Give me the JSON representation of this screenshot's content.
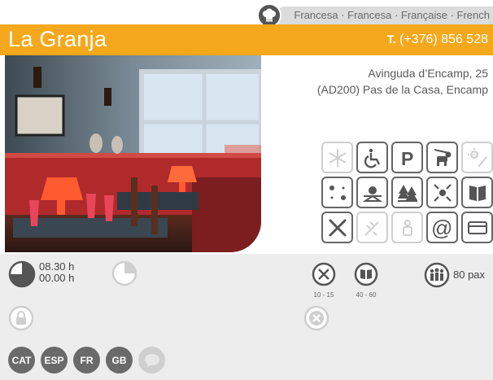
{
  "cuisine": {
    "text": "Francesa · Francesa · Française · French"
  },
  "restaurant": {
    "name": "La Granja",
    "phone_prefix": "T.",
    "phone": " (+376) 856 528",
    "address_line1": "Avinguda d’Encamp, 25",
    "address_line2": "(AD200) Pas de la Casa, Encamp"
  },
  "hours": {
    "open": "08.30 h",
    "close": "00.00 h"
  },
  "prices": {
    "menu": "10 - 15",
    "carta": "40 - 60"
  },
  "capacity": {
    "label": "80 pax"
  },
  "languages": [
    "CAT",
    "ESP",
    "FR",
    "GB"
  ],
  "colors": {
    "accent": "#f6a81c",
    "panel": "#ededed",
    "icon": "#666666",
    "icon_off": "#cfcfcf"
  },
  "amenities": [
    {
      "name": "air-conditioning-icon",
      "active": false
    },
    {
      "name": "wheelchair-access-icon",
      "active": true
    },
    {
      "name": "parking-icon",
      "active": true
    },
    {
      "name": "pets-allowed-icon",
      "active": true
    },
    {
      "name": "summer-terrace-icon",
      "active": false
    },
    {
      "name": "terrace-icon",
      "active": true
    },
    {
      "name": "sunset-view-icon",
      "active": true
    },
    {
      "name": "forest-view-icon",
      "active": true
    },
    {
      "name": "kids-area-icon",
      "active": true
    },
    {
      "name": "menu-book-icon",
      "active": true
    },
    {
      "name": "restaurant-cutlery-icon",
      "active": true
    },
    {
      "name": "gluten-free-icon",
      "active": false
    },
    {
      "name": "vegetarian-icon",
      "active": false
    },
    {
      "name": "email-icon",
      "active": true
    },
    {
      "name": "credit-card-icon",
      "active": true
    }
  ]
}
